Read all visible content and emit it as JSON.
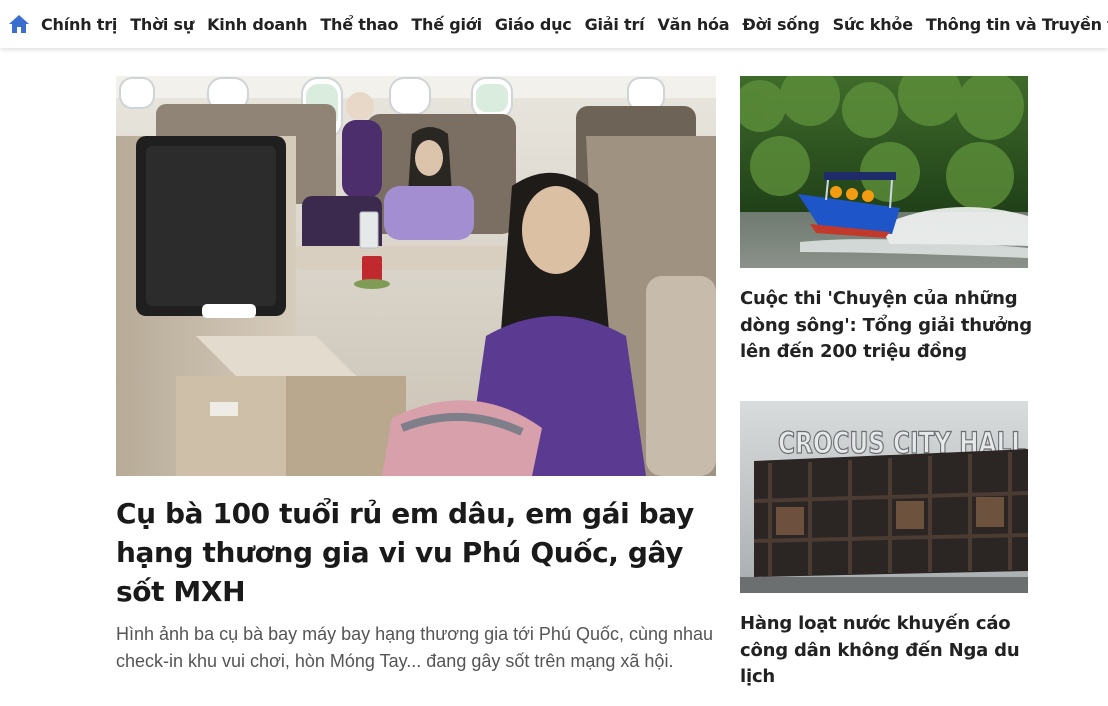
{
  "nav": {
    "home_icon": "home-icon",
    "items": [
      "Chính trị",
      "Thời sự",
      "Kinh doanh",
      "Thể thao",
      "Thế giới",
      "Giáo dục",
      "Giải trí",
      "Văn hóa",
      "Đời sống",
      "Sức khỏe",
      "Thông tin và Truyền thông"
    ]
  },
  "main_article": {
    "title": "Cụ bà 100 tuổi rủ em dâu, em gái bay hạng thương gia vi vu Phú Quốc, gây sốt MXH",
    "sapo": "Hình ảnh ba cụ bà bay máy bay hạng thương gia tới Phú Quốc, cùng nhau check-in khu vui chơi, hòn Móng Tay... đang gây sốt trên mạng xã hội."
  },
  "side_articles": [
    {
      "title": "Cuộc thi 'Chuyện của những dòng sông': Tổng giải thưởng lên đến 200 triệu đồng"
    },
    {
      "title": "Hàng loạt nước khuyến cáo công dân không đến Nga du lịch",
      "image_sign": "CROCUS CITY HALL"
    }
  ],
  "colors": {
    "home_icon": "#3a6fd0",
    "nav_text": "#222222",
    "title_text": "#1a1a1a",
    "sapo_text": "#555555"
  }
}
